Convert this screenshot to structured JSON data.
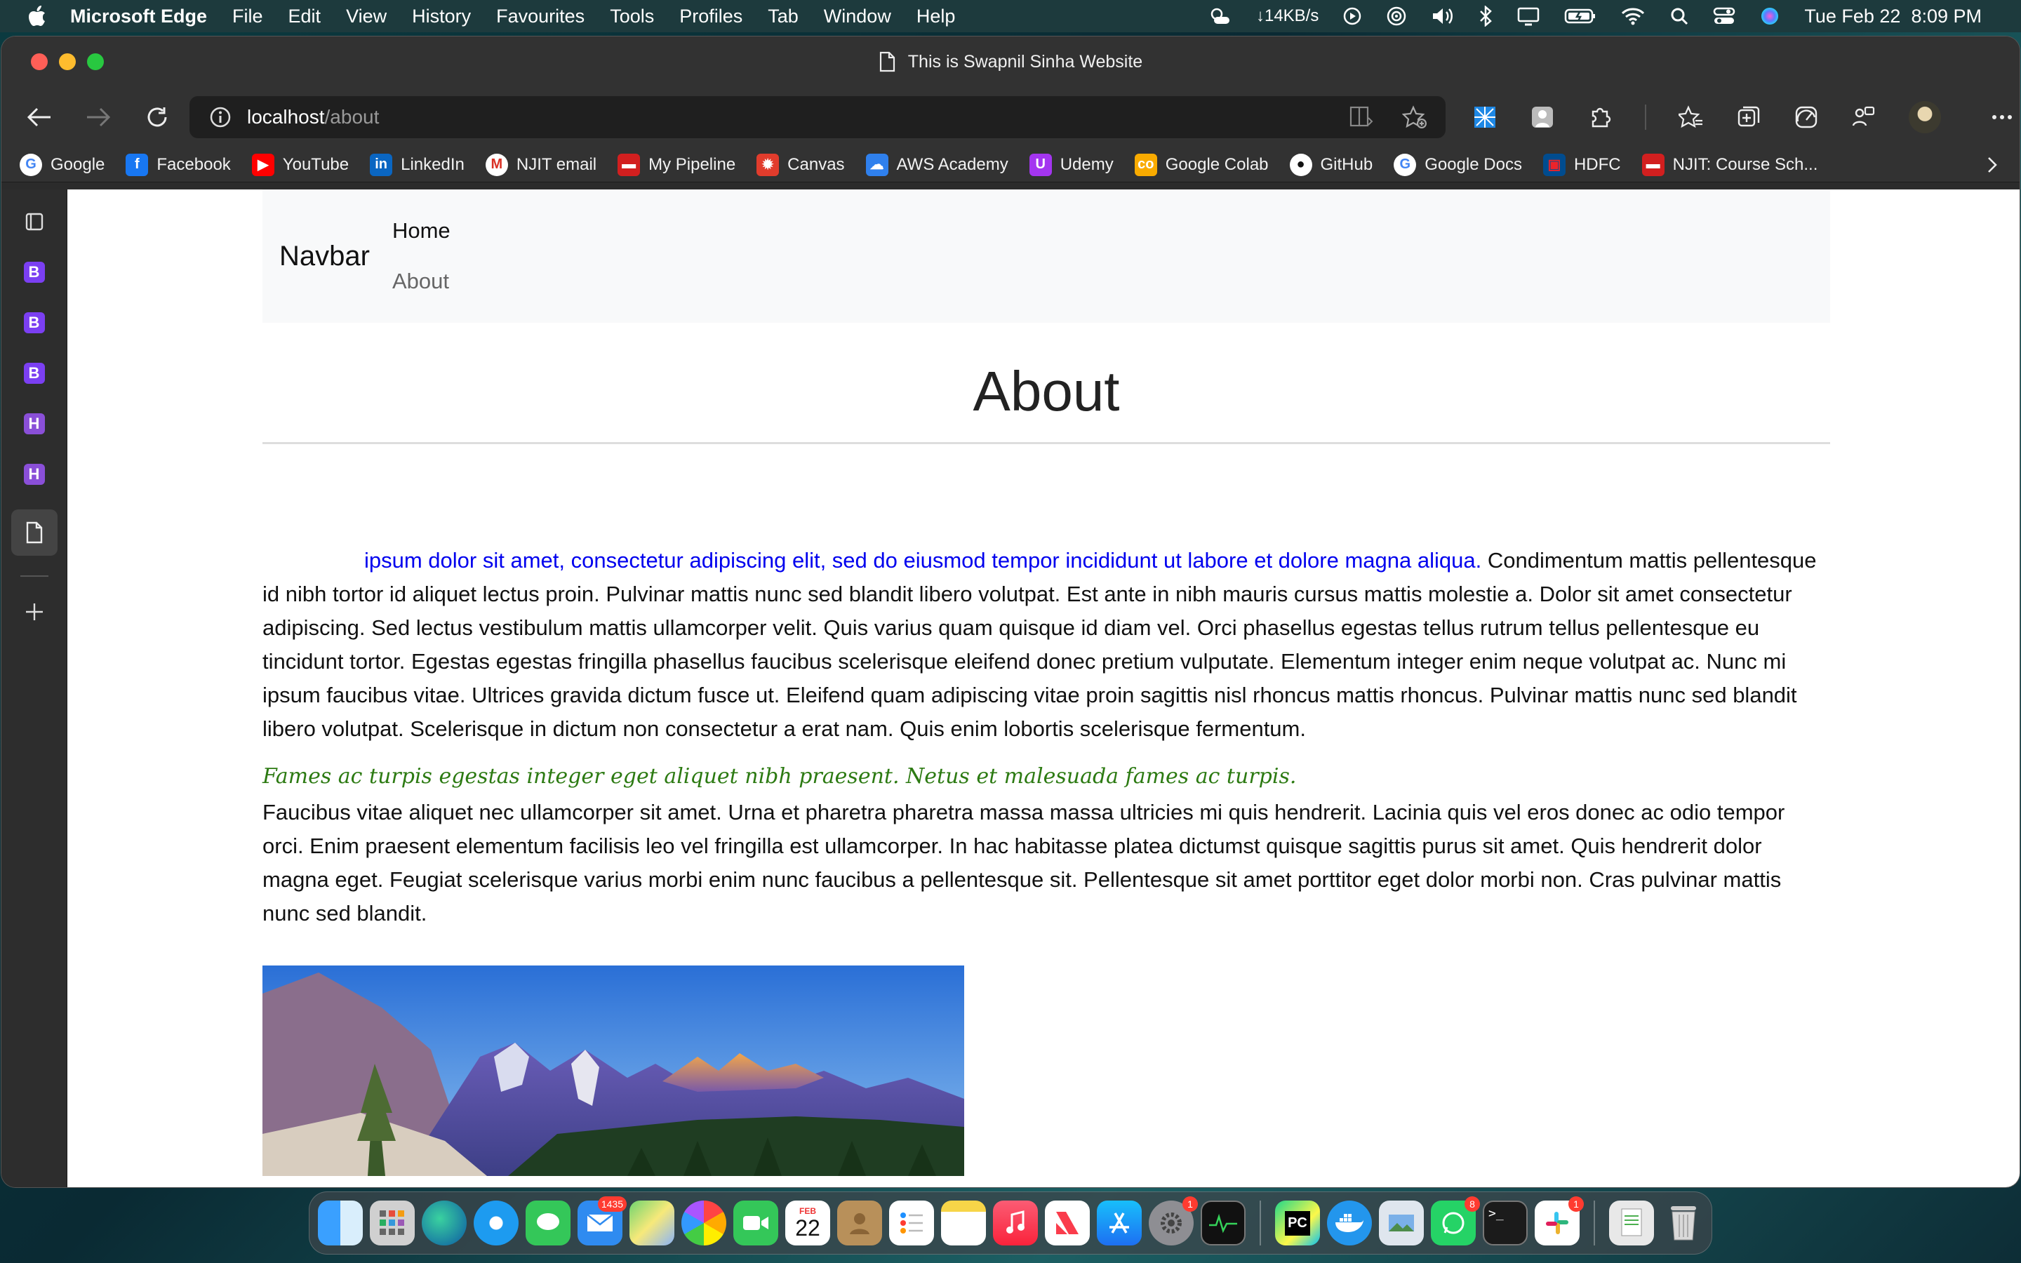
{
  "menubar": {
    "app_name": "Microsoft Edge",
    "menus": [
      "File",
      "Edit",
      "View",
      "History",
      "Favourites",
      "Tools",
      "Profiles",
      "Tab",
      "Window",
      "Help"
    ],
    "net_speed": "↓14KB/s",
    "datetime": "Tue Feb 22  8:09 PM"
  },
  "window": {
    "tab_title": "This is Swapnil Sinha Website",
    "address_host": "localhost",
    "address_path": "/about"
  },
  "bookmarks": [
    {
      "label": "Google",
      "icon": "google-icon",
      "color": "#ffffff",
      "glyph": "G",
      "fg": "#4285f4"
    },
    {
      "label": "Facebook",
      "icon": "facebook-icon",
      "color": "#1877f2",
      "glyph": "f",
      "fg": "#ffffff"
    },
    {
      "label": "YouTube",
      "icon": "youtube-icon",
      "color": "#ff0000",
      "glyph": "▶",
      "fg": "#ffffff"
    },
    {
      "label": "LinkedIn",
      "icon": "linkedin-icon",
      "color": "#0a66c2",
      "glyph": "in",
      "fg": "#ffffff"
    },
    {
      "label": "NJIT email",
      "icon": "gmail-icon",
      "color": "#ffffff",
      "glyph": "M",
      "fg": "#d93025"
    },
    {
      "label": "My Pipeline",
      "icon": "pipeline-icon",
      "color": "#d21f1f",
      "glyph": "▬",
      "fg": "#ffffff"
    },
    {
      "label": "Canvas",
      "icon": "canvas-icon",
      "color": "#e13c2c",
      "glyph": "✹",
      "fg": "#ffffff"
    },
    {
      "label": "AWS Academy",
      "icon": "aws-cloud-icon",
      "color": "#2f80ed",
      "glyph": "☁",
      "fg": "#ffffff"
    },
    {
      "label": "Udemy",
      "icon": "udemy-icon",
      "color": "#a435f0",
      "glyph": "U",
      "fg": "#ffffff"
    },
    {
      "label": "Google Colab",
      "icon": "colab-icon",
      "color": "#f9ab00",
      "glyph": "co",
      "fg": "#ffffff"
    },
    {
      "label": "GitHub",
      "icon": "github-icon",
      "color": "#ffffff",
      "glyph": "●",
      "fg": "#111111"
    },
    {
      "label": "Google Docs",
      "icon": "google-icon",
      "color": "#ffffff",
      "glyph": "G",
      "fg": "#4285f4"
    },
    {
      "label": "HDFC",
      "icon": "hdfc-icon",
      "color": "#004c8f",
      "glyph": "▣",
      "fg": "#ed232a"
    },
    {
      "label": "NJIT: Course Sch...",
      "icon": "njit-icon",
      "color": "#d21f1f",
      "glyph": "▬",
      "fg": "#ffffff"
    }
  ],
  "sidebar_badges": {
    "b": "B",
    "h": "H"
  },
  "navbar": {
    "brand": "Navbar",
    "home": "Home",
    "about": "About"
  },
  "content": {
    "heading": "About",
    "para1_blue": "ipsum dolor sit amet, consectetur adipiscing elit, sed do eiusmod tempor incididunt ut labore et dolore magna aliqua.",
    "para1_rest": " Condimentum mattis pellentesque id nibh tortor id aliquet lectus proin. Pulvinar mattis nunc sed blandit libero volutpat. Est ante in nibh mauris cursus mattis molestie a. Dolor sit amet consectetur adipiscing. Sed lectus vestibulum mattis ullamcorper velit. Quis varius quam quisque id diam vel. Orci phasellus egestas tellus rutrum tellus pellentesque eu tincidunt tortor. Egestas egestas fringilla phasellus faucibus scelerisque eleifend donec pretium vulputate. Elementum integer enim neque volutpat ac. Nunc mi ipsum faucibus vitae. Ultrices gravida dictum fusce ut. Eleifend quam adipiscing vitae proin sagittis nisl rhoncus mattis rhoncus. Pulvinar mattis nunc sed blandit libero volutpat. Scelerisque in dictum non consectetur a erat nam. Quis enim lobortis scelerisque fermentum.",
    "green_line": "Fames ac turpis egestas integer eget aliquet nibh praesent. Netus et malesuada fames ac turpis.",
    "para2": "Faucibus vitae aliquet nec ullamcorper sit amet. Urna et pharetra pharetra massa massa ultricies mi quis hendrerit. Lacinia quis vel eros donec ac odio tempor orci. Enim praesent elementum facilisis leo vel fringilla est ullamcorper. In hac habitasse platea dictumst quisque sagittis purus sit amet. Quis hendrerit dolor magna eget. Feugiat scelerisque varius morbi enim nunc faucibus a pellentesque sit. Pellentesque sit amet porttitor eget dolor morbi non. Cras pulvinar mattis nunc sed blandit."
  },
  "dock": {
    "mail_badge": "1435",
    "calendar_month": "FEB",
    "calendar_day": "22",
    "settings_badge": "1",
    "pycharm_label": "PC",
    "whatsapp_badge": "8",
    "slack_badge": "1",
    "terminal_prompt": ">_"
  },
  "colors": {
    "link_blue": "#0000ee",
    "green_text": "#2c7a12",
    "navbar_bg": "#f8f9fa"
  }
}
